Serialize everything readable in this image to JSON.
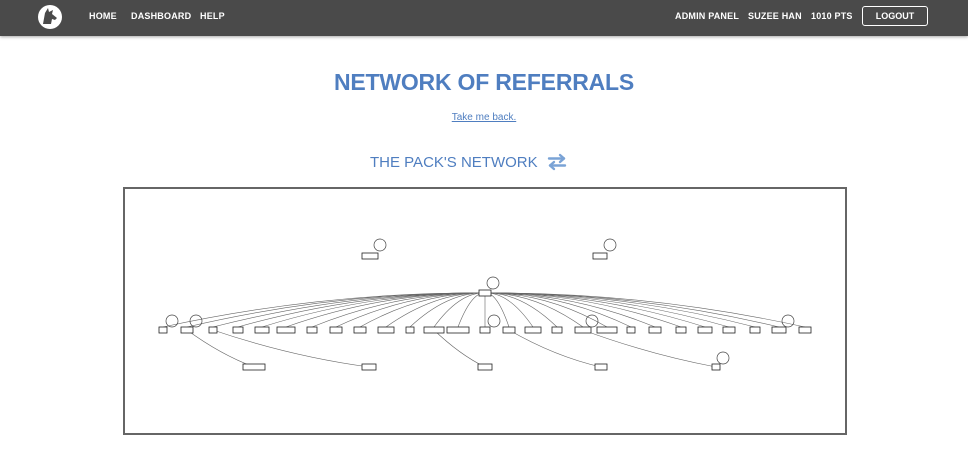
{
  "navbar": {
    "logo_icon": "wolf-logo-icon",
    "links": [
      {
        "label": "HOME"
      },
      {
        "label": "DASHBOARD"
      },
      {
        "label": "HELP"
      }
    ],
    "admin_panel": "ADMIN PANEL",
    "user_name": "SUZEE HAN",
    "points": "1010 PTS",
    "logout_label": "LOGOUT"
  },
  "page": {
    "title": "NETWORK OF REFERRALS",
    "back_link": "Take me back.",
    "section_title": "THE PACK'S NETWORK",
    "swap_icon": "swap-arrows-icon"
  },
  "colors": {
    "navbar_bg": "#4a4a4a",
    "accent": "#4f7ec0",
    "graph_border": "#666666"
  }
}
